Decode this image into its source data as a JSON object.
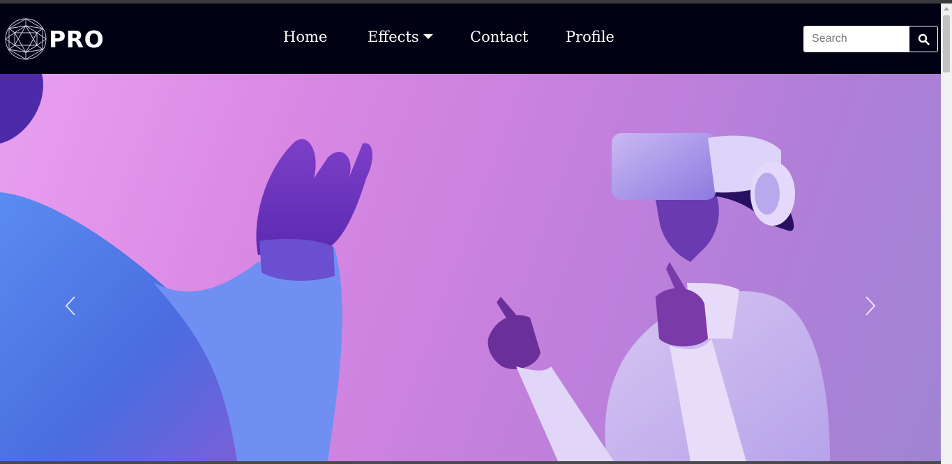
{
  "brand": {
    "name": "PRO",
    "logo_icon": "geodesic-sphere-icon"
  },
  "nav": {
    "items": [
      {
        "label": "Home"
      },
      {
        "label": "Effects",
        "has_dropdown": true
      },
      {
        "label": "Contact"
      },
      {
        "label": "Profile"
      }
    ]
  },
  "search": {
    "placeholder": "Search",
    "value": "",
    "button_icon": "search-icon"
  },
  "carousel": {
    "prev_icon": "chevron-left-icon",
    "next_icon": "chevron-right-icon",
    "slide_image": "woman wearing VR headset with purple lighting"
  },
  "colors": {
    "navbar": "#010114",
    "accent": "#c680de"
  }
}
